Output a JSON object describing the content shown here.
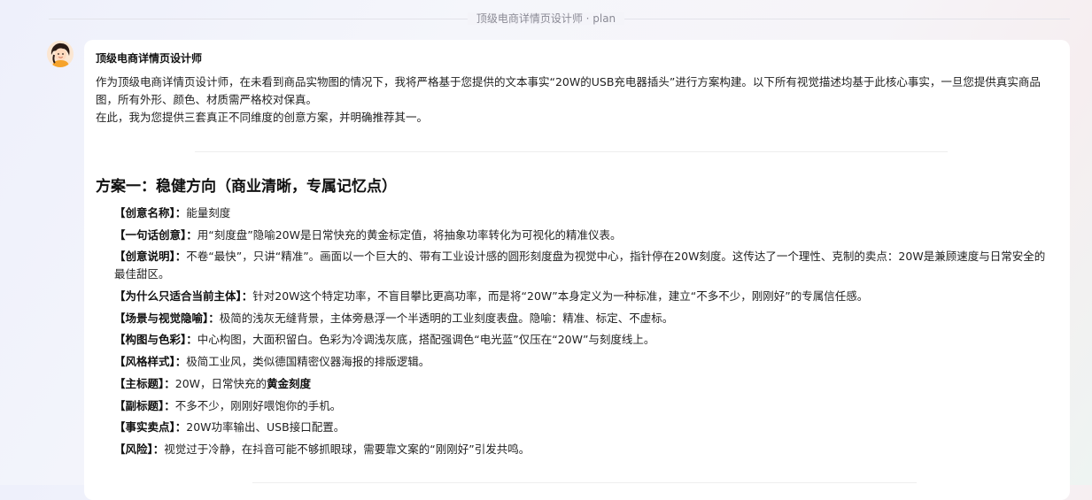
{
  "header": {
    "title": "顶级电商详情页设计师 · plan"
  },
  "message": {
    "author": "顶级电商详情页设计师",
    "intro": [
      "作为顶级电商详情页设计师，在未看到商品实物图的情况下，我将严格基于您提供的文本事实“20W的USB充电器插头”进行方案构建。以下所有视觉描述均基于此核心事实，一旦您提供真实商品图，所有外形、颜色、材质需严格校对保真。",
      "在此，我为您提供三套真正不同维度的创意方案，并明确推荐其一。"
    ],
    "scheme": {
      "title": "方案一：稳健方向（商业清晰，专属记忆点）",
      "items": [
        {
          "key": "【创意名称】：",
          "value": "能量刻度"
        },
        {
          "key": "【一句话创意】：",
          "value": "用“刻度盘”隐喻20W是日常快充的黄金标定值，将抽象功率转化为可视化的精准仪表。"
        },
        {
          "key": "【创意说明】：",
          "value": "不卷“最快”，只讲“精准”。画面以一个巨大的、带有工业设计感的圆形刻度盘为视觉中心，指针停在20W刻度。这传达了一个理性、克制的卖点：20W是兼顾速度与日常安全的最佳甜区。"
        },
        {
          "key": "【为什么只适合当前主体】：",
          "value": "针对20W这个特定功率，不盲目攀比更高功率，而是将“20W”本身定义为一种标准，建立“不多不少，刚刚好”的专属信任感。"
        },
        {
          "key": "【场景与视觉隐喻】：",
          "value": "极简的浅灰无缝背景，主体旁悬浮一个半透明的工业刻度表盘。隐喻：精准、标定、不虚标。"
        },
        {
          "key": "【构图与色彩】：",
          "value": "中心构图，大面积留白。色彩为冷调浅灰底，搭配强调色“电光蓝”仅压在“20W”与刻度线上。"
        },
        {
          "key": "【风格样式】：",
          "value": "极简工业风，类似德国精密仪器海报的排版逻辑。"
        },
        {
          "key": "【主标题】：",
          "value": "20W，日常快充的",
          "emphasis": "黄金刻度"
        },
        {
          "key": "【副标题】：",
          "value": "不多不少，刚刚好喂饱你的手机。"
        },
        {
          "key": "【事实卖点】：",
          "value": "20W功率输出、USB接口配置。"
        },
        {
          "key": "【风险】：",
          "value": "视觉过于冷静，在抖音可能不够抓眼球，需要靠文案的“刚刚好”引发共鸣。"
        }
      ]
    }
  },
  "colors": {
    "card_bg": "#ffffff",
    "text": "#222222",
    "muted": "#8a8a95"
  },
  "icons": {
    "avatar": "designer-avatar-icon"
  }
}
